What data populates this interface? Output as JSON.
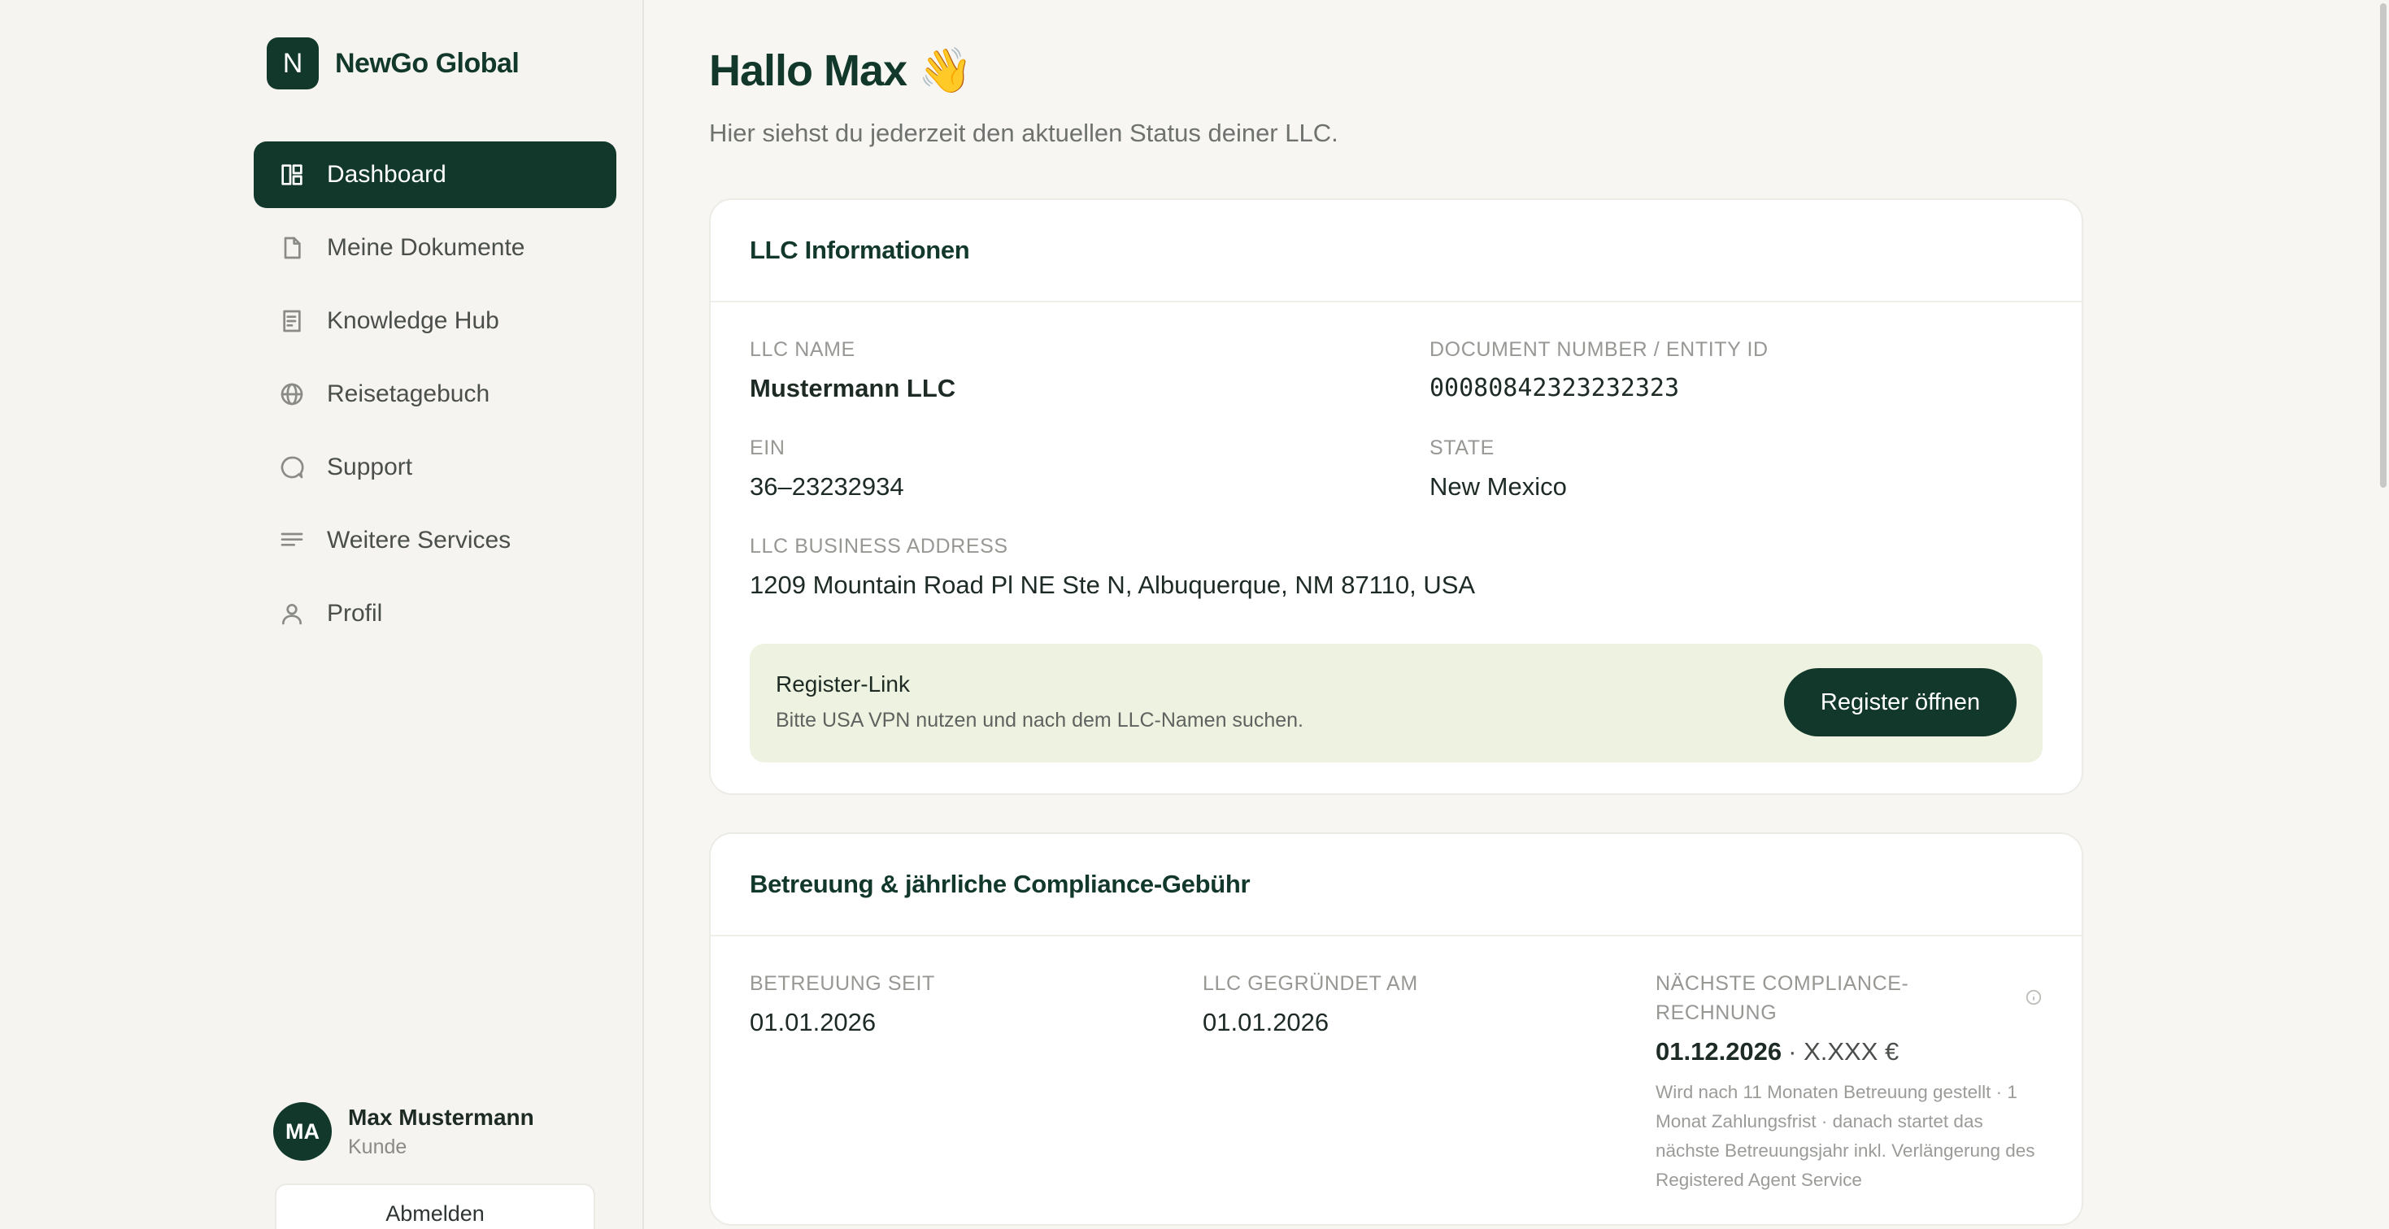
{
  "brand": {
    "logo_letter": "N",
    "name": "NewGo Global"
  },
  "sidebar": {
    "items": [
      {
        "label": "Dashboard",
        "icon": "dashboard-icon",
        "active": true
      },
      {
        "label": "Meine Dokumente",
        "icon": "document-icon"
      },
      {
        "label": "Knowledge Hub",
        "icon": "book-icon"
      },
      {
        "label": "Reisetagebuch",
        "icon": "globe-icon"
      },
      {
        "label": "Support",
        "icon": "chat-icon"
      },
      {
        "label": "Weitere Services",
        "icon": "list-icon"
      },
      {
        "label": "Profil",
        "icon": "user-icon"
      }
    ]
  },
  "user": {
    "initials": "MA",
    "name": "Max Mustermann",
    "role": "Kunde",
    "logout_label": "Abmelden"
  },
  "header": {
    "greeting": "Hallo Max 👋",
    "subtitle": "Hier siehst du jederzeit den aktuellen Status deiner LLC."
  },
  "llc_card": {
    "title": "LLC Informationen",
    "llc_name_label": "LLC NAME",
    "llc_name": "Mustermann LLC",
    "doc_number_label": "DOCUMENT NUMBER / ENTITY ID",
    "doc_number": "00080842323232323",
    "ein_label": "EIN",
    "ein": "36–23232934",
    "state_label": "STATE",
    "state": "New Mexico",
    "address_label": "LLC BUSINESS ADDRESS",
    "address": "1209 Mountain Road Pl NE Ste N, Albuquerque, NM 87110, USA",
    "register": {
      "title": "Register-Link",
      "description": "Bitte USA VPN nutzen und nach dem LLC-Namen suchen.",
      "button_label": "Register öffnen"
    }
  },
  "compliance_card": {
    "title": "Betreuung & jährliche Compliance-Gebühr",
    "since_label": "BETREUUNG SEIT",
    "since": "01.01.2026",
    "founded_label": "LLC GEGRÜNDET AM",
    "founded": "01.01.2026",
    "next_label_line1": "NÄCHSTE COMPLIANCE-",
    "next_label_line2": "RECHNUNG",
    "next_date": "01.12.2026",
    "next_amount": "· X.XXX €",
    "note": "Wird nach 11 Monaten Betreuung gestellt · 1 Monat Zahlungsfrist · danach startet das nächste Betreuungsjahr inkl. Verlängerung des Registered Agent Service"
  },
  "colors": {
    "brand": "#11382a",
    "background": "#f7f6f3",
    "register_bg": "#eef3e1"
  }
}
